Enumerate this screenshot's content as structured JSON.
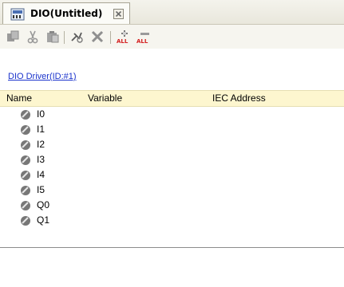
{
  "tab": {
    "title": "DIO(Untitled)"
  },
  "driver_link": "DIO Driver(ID:#1)",
  "table": {
    "columns": [
      "Name",
      "Variable",
      "IEC Address"
    ],
    "rows": [
      {
        "name": "I0"
      },
      {
        "name": "I1"
      },
      {
        "name": "I2"
      },
      {
        "name": "I3"
      },
      {
        "name": "I4"
      },
      {
        "name": "I5"
      },
      {
        "name": "Q0"
      },
      {
        "name": "Q1"
      }
    ]
  },
  "toolbar": {
    "buttons": [
      "copy-icon",
      "cut-icon",
      "paste-icon",
      "properties-icon",
      "delete-icon",
      "add-all-icon",
      "remove-all-icon"
    ],
    "all_label": "ALL"
  },
  "colors": {
    "header_bg": "#fdf6cf",
    "link": "#1a33cc",
    "accent_red": "#d42020"
  }
}
